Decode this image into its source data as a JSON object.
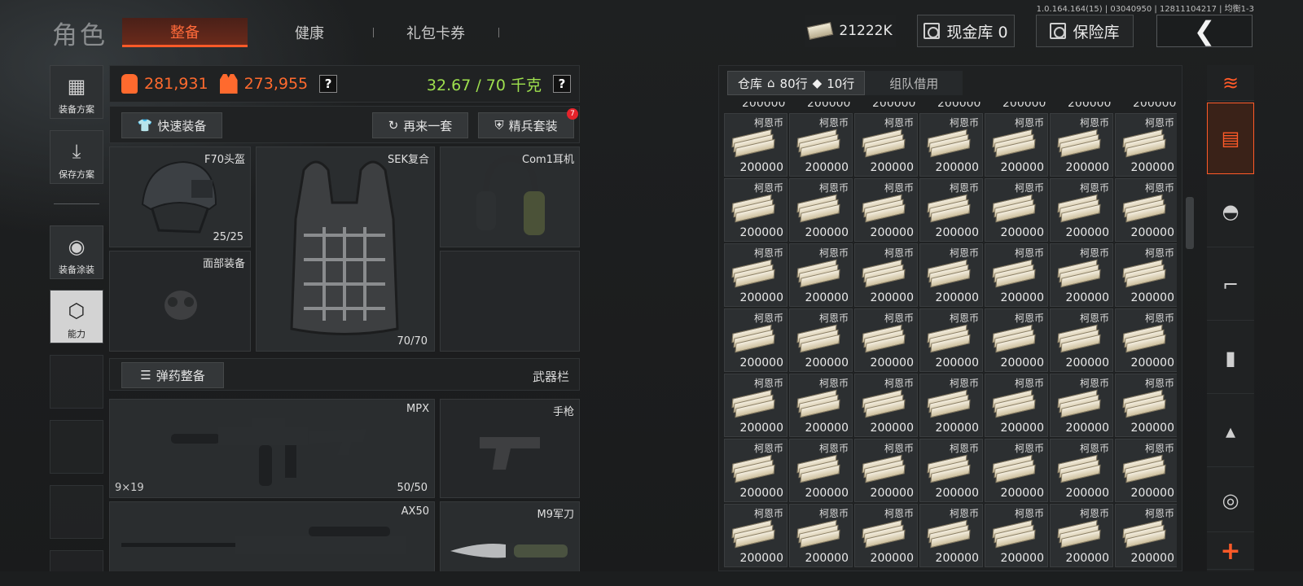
{
  "version": "1.0.164.164(15) | 03040950 | 12811104217 | 均衡1-3",
  "header": {
    "title": "角色",
    "tabs": [
      {
        "label": "整备",
        "active": true
      },
      {
        "label": "健康"
      },
      {
        "label": "礼包卡券"
      }
    ],
    "cash": "21222K",
    "cash_vault": "现金库 0",
    "safe_vault": "保险库",
    "accent_color": "#ff5a28"
  },
  "sidebar": {
    "items": [
      {
        "label": "装备方案",
        "icon": "vest-icon"
      },
      {
        "label": "保存方案",
        "icon": "download-icon"
      },
      {
        "label": "装备涂装",
        "icon": "camo-icon"
      },
      {
        "label": "能力",
        "icon": "ability-icon",
        "active": true
      }
    ]
  },
  "stats": {
    "bag_value": "281,931",
    "vest_value": "273,955",
    "weight": "32.67 / 70 千克",
    "help": "?"
  },
  "actions": {
    "quick_equip": "快速装备",
    "again": "再来一套",
    "elite": "精兵套装",
    "elite_badge": "7"
  },
  "gear": {
    "helmet": {
      "label": "F70头盔",
      "count": "25/25"
    },
    "armor": {
      "label": "SEK复合",
      "count": "70/70"
    },
    "headset": {
      "label": "Com1耳机"
    },
    "face": {
      "label": "面部装备"
    }
  },
  "weapons": {
    "ammo_button": "弹药整备",
    "bar_label": "武器栏",
    "primary": {
      "label": "MPX",
      "caliber": "9×19",
      "count": "50/50"
    },
    "pistol": {
      "label": "手枪"
    },
    "secondary": {
      "label": "AX50"
    },
    "knife": {
      "label": "M9军刀"
    }
  },
  "storage": {
    "tab_label": "仓库",
    "rows_label": "80行",
    "rows_label2": "10行",
    "team_tab": "组队借用",
    "item_name": "柯恩币",
    "item_qty": "200000",
    "columns": 7,
    "rows": 7
  },
  "categories": [
    "all-icon",
    "storage-icon",
    "helmet-icon",
    "rifle-icon",
    "magazine-icon",
    "ammo-icon",
    "scope-icon",
    "add-icon"
  ]
}
